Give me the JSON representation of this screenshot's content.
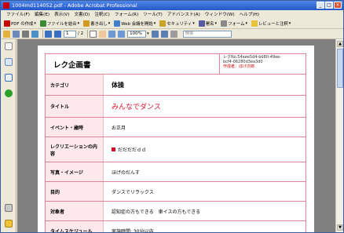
{
  "window": {
    "title": "1004md114052.pdf - Adobe Acrobat Professional"
  },
  "menu": [
    "ファイル(F)",
    "編集(E)",
    "表示(V)",
    "文書(D)",
    "注釈(C)",
    "フォーム(R)",
    "ツール(T)",
    "アドバンスト(A)",
    "ウィンドウ(W)",
    "ヘルプ(H)"
  ],
  "toolbar1": {
    "create_pdf": "PDF の作成",
    "combine": "ファイルを結合",
    "export": "書き出し",
    "review": "Web 会議を開始",
    "security": "セキュリティ",
    "sign": "署名",
    "forms": "フォーム",
    "review_comment": "レビューと注釈"
  },
  "toolbar2": {
    "page_current": "1",
    "page_total": "/ 2",
    "zoom": "100%",
    "search_placeholder": "検索"
  },
  "colors": {
    "accent_border": "#e28496",
    "label_bg": "#fde8ec",
    "title_red": "#d4102a"
  },
  "form": {
    "title": "レク企画書",
    "meta_line1": "レクNo.54aee5d4-bd80-49ee-",
    "meta_line2": "bcf4-06280d3ea3d0",
    "meta_author": "作成者：ほげ次郎",
    "rows": [
      {
        "label": "カテゴリ",
        "value": "体操"
      },
      {
        "label": "タイトル",
        "value": "みんなでダンス"
      },
      {
        "label": "イベント・歳時",
        "value": "お正月"
      },
      {
        "label": "レクリエーションの内容",
        "value": "だだだだｄｄ"
      },
      {
        "label": "写真・イメージ",
        "value": "ほげのだんす"
      },
      {
        "label": "目的",
        "value": "ダンスでリラックス"
      },
      {
        "label": "対象者",
        "value": "認知症の方もできる　車イスの方もできる"
      },
      {
        "label": "タイムスケジュール",
        "value": "実施時間: 30分以内"
      }
    ]
  }
}
